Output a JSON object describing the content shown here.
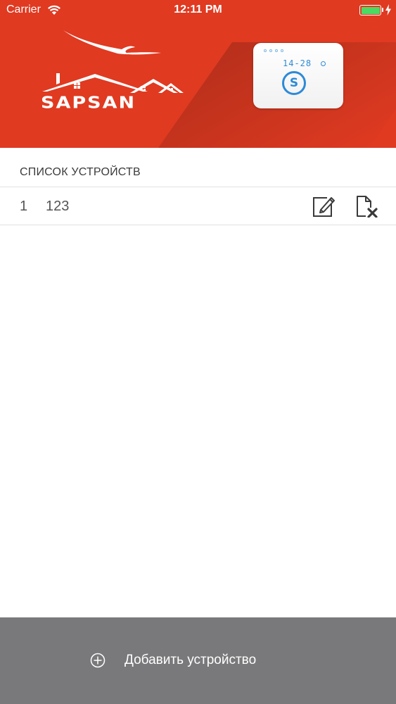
{
  "status_bar": {
    "carrier": "Carrier",
    "time": "12:11 PM",
    "battery_color": "#4cd964"
  },
  "banner": {
    "background_color": "#e03a21",
    "logo_text": "SAPSAN",
    "device_display": "14-28",
    "device_button_letter": "S",
    "device_accent_color": "#2d8ad8"
  },
  "device_list": {
    "title": "СПИСОК УСТРОЙСТВ",
    "items": [
      {
        "number": "1",
        "name": "123",
        "edit_icon": "edit-icon",
        "delete_icon": "delete-file-icon"
      }
    ]
  },
  "bottom_bar": {
    "background_color": "#79797b",
    "add_label": "Добавить устройство",
    "add_icon": "plus-circle-icon"
  }
}
